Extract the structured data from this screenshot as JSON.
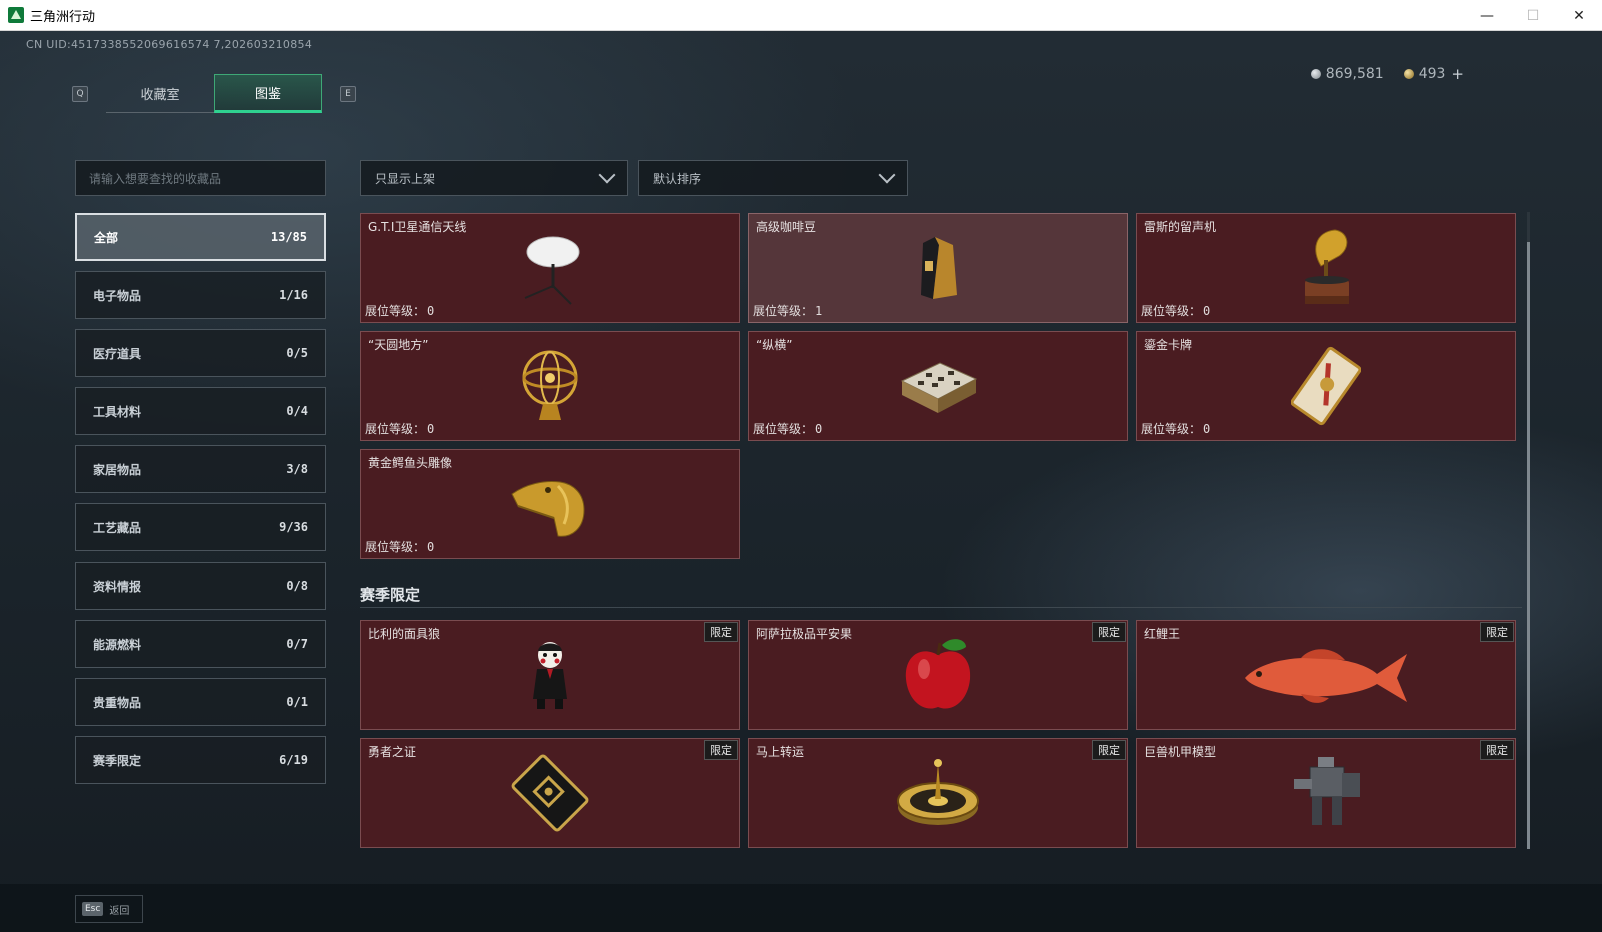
{
  "window": {
    "title": "三角洲行动",
    "minimize": "—",
    "maximize": "☐",
    "close": "✕"
  },
  "uid": "CN UID:4517338552069616574 7,202603210854",
  "keys": {
    "left": "Q",
    "right": "E",
    "back": "Esc"
  },
  "tabs": [
    {
      "label": "收藏室",
      "active": false
    },
    {
      "label": "图鉴",
      "active": true
    }
  ],
  "currency": {
    "silver": "869,581",
    "gold": "493",
    "plus": "+"
  },
  "search": {
    "placeholder": "请输入想要查找的收藏品"
  },
  "filters": {
    "shelf": "只显示上架",
    "sort": "默认排序"
  },
  "categories": [
    {
      "label": "全部",
      "count": "13/85",
      "active": true
    },
    {
      "label": "电子物品",
      "count": "1/16"
    },
    {
      "label": "医疗道具",
      "count": "0/5"
    },
    {
      "label": "工具材料",
      "count": "0/4"
    },
    {
      "label": "家居物品",
      "count": "3/8"
    },
    {
      "label": "工艺藏品",
      "count": "9/36"
    },
    {
      "label": "资料情报",
      "count": "0/8"
    },
    {
      "label": "能源燃料",
      "count": "0/7"
    },
    {
      "label": "贵重物品",
      "count": "0/1"
    },
    {
      "label": "赛季限定",
      "count": "6/19"
    }
  ],
  "level_label": "展位等级：",
  "items": [
    {
      "name": "G.T.I卫星通信天线",
      "level": "0",
      "icon": "satellite-dish"
    },
    {
      "name": "高级咖啡豆",
      "level": "1",
      "icon": "coffee-bag",
      "owned": true
    },
    {
      "name": "雷斯的留声机",
      "level": "0",
      "icon": "gramophone"
    },
    {
      "name": "“天圆地方”",
      "level": "0",
      "icon": "armillary-sphere"
    },
    {
      "name": "“纵横”",
      "level": "0",
      "icon": "chess-box"
    },
    {
      "name": "鎏金卡牌",
      "level": "0",
      "icon": "gilded-card"
    },
    {
      "name": "黄金鳄鱼头雕像",
      "level": "0",
      "icon": "gold-crocodile-head"
    }
  ],
  "season": {
    "title": "赛季限定",
    "badge": "限定",
    "items": [
      {
        "name": "比利的面具狼",
        "icon": "puppet-figure"
      },
      {
        "name": "阿萨拉极品平安果",
        "icon": "red-apple"
      },
      {
        "name": "红鲤王",
        "icon": "red-carp"
      },
      {
        "name": "勇者之证",
        "icon": "brave-card"
      },
      {
        "name": "马上转运",
        "icon": "fortune-wheel"
      },
      {
        "name": "巨兽机甲模型",
        "icon": "mech-model"
      }
    ]
  },
  "back_label": "返回"
}
